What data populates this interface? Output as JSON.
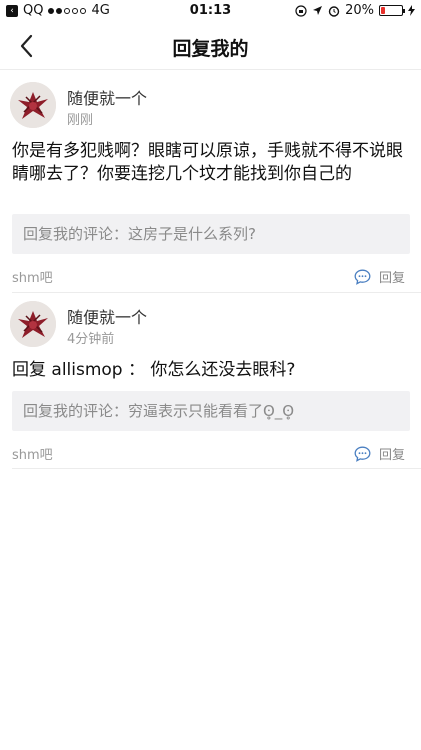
{
  "status_bar": {
    "carrier": "QQ",
    "network": "4G",
    "time": "01:13",
    "battery": "20%",
    "battery_level": 0.2,
    "signal_bars_on": 2,
    "signal_bars_total": 5
  },
  "nav": {
    "title": "回复我的"
  },
  "comments": [
    {
      "username": "随便就一个",
      "time": "刚刚",
      "content": "你是有多犯贱啊？眼瞎可以原谅，手贱就不得不说眼睛哪去了？你要连挖几个坟才能找到你自己的",
      "quote": "回复我的评论：这房子是什么系列?",
      "forum": "shm吧",
      "reply_label": "回复"
    },
    {
      "username": "随便就一个",
      "time": "4分钟前",
      "content": "回复 allismop ： 你怎么还没去眼科?",
      "quote": "回复我的评论：穷逼表示只能看看了ʘ̥_ʘ̥",
      "forum": "shm吧",
      "reply_label": "回复"
    }
  ],
  "colors": {
    "accent_blue": "#4a7fc1",
    "battery_red": "#e8312c",
    "quote_bg": "#f1f1f3"
  },
  "icons": {
    "back": "chevron-left-icon",
    "reply": "comment-bubble-icon",
    "location": "location-arrow-icon",
    "alarm": "alarm-icon",
    "lock_rotation": "rotation-lock-icon",
    "charging": "bolt-icon"
  }
}
